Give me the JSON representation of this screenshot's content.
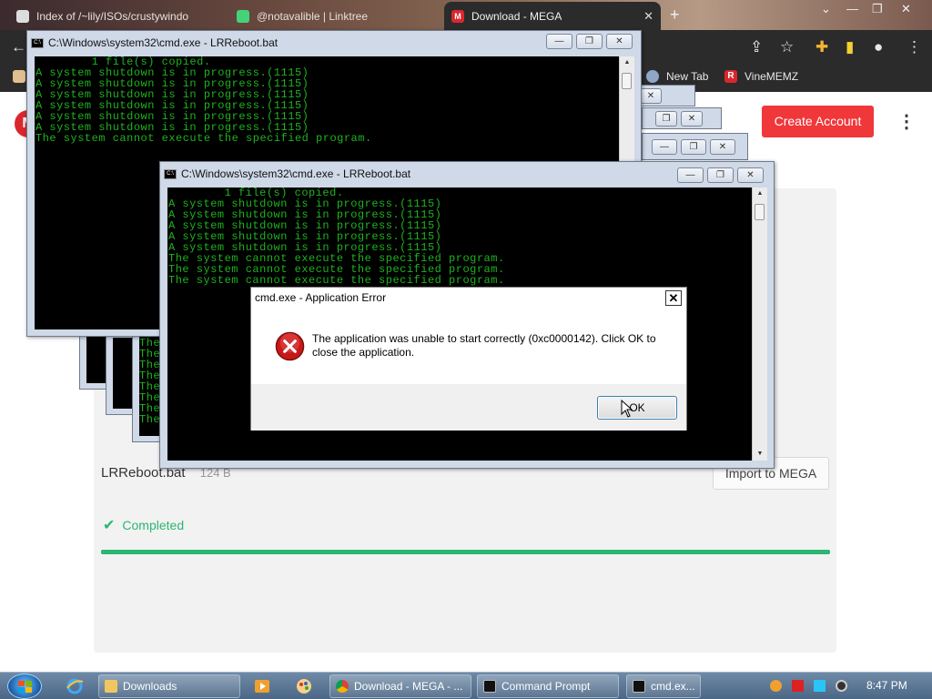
{
  "browser": {
    "tabs": [
      {
        "label": "Index of /~lily/ISOs/crustywindo",
        "active": false
      },
      {
        "label": "@notavalible | Linktree",
        "active": false
      },
      {
        "label": "Download - MEGA",
        "active": true
      }
    ],
    "bookmarks": [
      {
        "label": "New Tab"
      },
      {
        "label": "VineMEMZ"
      }
    ]
  },
  "mega": {
    "logo_letter": "M",
    "create_account_label": "Create Account",
    "file_name": "LRReboot.bat",
    "file_size": "124 B",
    "import_label": "Import to MEGA",
    "status": "Completed",
    "progress": 1.0,
    "accent_color": "#2bb673"
  },
  "cmd_back": {
    "title": "C:\\Windows\\system32\\cmd.exe - LRReboot.bat",
    "lines": [
      "        1 file(s) copied.",
      "A system shutdown is in progress.(1115)",
      "A system shutdown is in progress.(1115)",
      "A system shutdown is in progress.(1115)",
      "A system shutdown is in progress.(1115)",
      "A system shutdown is in progress.(1115)",
      "A system shutdown is in progress.(1115)",
      "The system cannot execute the specified program."
    ]
  },
  "cmd_front": {
    "title": "C:\\Windows\\system32\\cmd.exe - LRReboot.bat",
    "lines": [
      "        1 file(s) copied.",
      "A system shutdown is in progress.(1115)",
      "A system shutdown is in progress.(1115)",
      "A system shutdown is in progress.(1115)",
      "A system shutdown is in progress.(1115)",
      "A system shutdown is in progress.(1115)",
      "The system cannot execute the specified program.",
      "The system cannot execute the specified program.",
      "The system cannot execute the specified program."
    ]
  },
  "cmd_stub_lines": [
    "The",
    "The",
    "The",
    "The",
    "The",
    "The",
    "The",
    "The"
  ],
  "error_dialog": {
    "title": "cmd.exe - Application Error",
    "message": "The application was unable to start correctly (0xc0000142). Click OK to close the application.",
    "ok_label": "OK"
  },
  "taskbar": {
    "tasks": [
      {
        "label": "Downloads",
        "icon": "folder-icon"
      },
      {
        "label": "Download - MEGA - ...",
        "icon": "chrome-icon"
      },
      {
        "label": "Command Prompt",
        "icon": "cmd-icon"
      },
      {
        "label": "cmd.ex...",
        "icon": "cmd-icon"
      }
    ],
    "time": "8:47 PM"
  },
  "icons": {
    "back": "arrow-left-icon",
    "share": "share-icon",
    "star": "star-icon",
    "extensions": "puzzle-icon",
    "sidepanel": "sidepanel-icon",
    "profile": "profile-icon",
    "menu": "kebab-icon",
    "error": "error-x-icon"
  }
}
